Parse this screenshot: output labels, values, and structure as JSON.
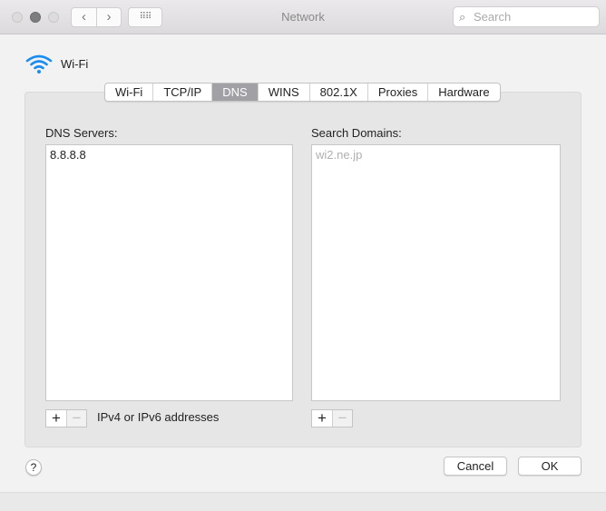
{
  "window": {
    "title": "Network",
    "search_placeholder": "Search"
  },
  "interface": {
    "name": "Wi-Fi",
    "accent": "#1a8cf0"
  },
  "tabs": [
    {
      "label": "Wi-Fi"
    },
    {
      "label": "TCP/IP"
    },
    {
      "label": "DNS",
      "active": true
    },
    {
      "label": "WINS"
    },
    {
      "label": "802.1X"
    },
    {
      "label": "Proxies"
    },
    {
      "label": "Hardware"
    }
  ],
  "dns": {
    "label": "DNS Servers:",
    "servers": [
      "8.8.8.8"
    ],
    "hint": "IPv4 or IPv6 addresses"
  },
  "search_domains": {
    "label": "Search Domains:",
    "domains": [
      "wi2.ne.jp"
    ]
  },
  "buttons": {
    "add": "+",
    "remove": "−",
    "help": "?",
    "cancel": "Cancel",
    "ok": "OK"
  }
}
